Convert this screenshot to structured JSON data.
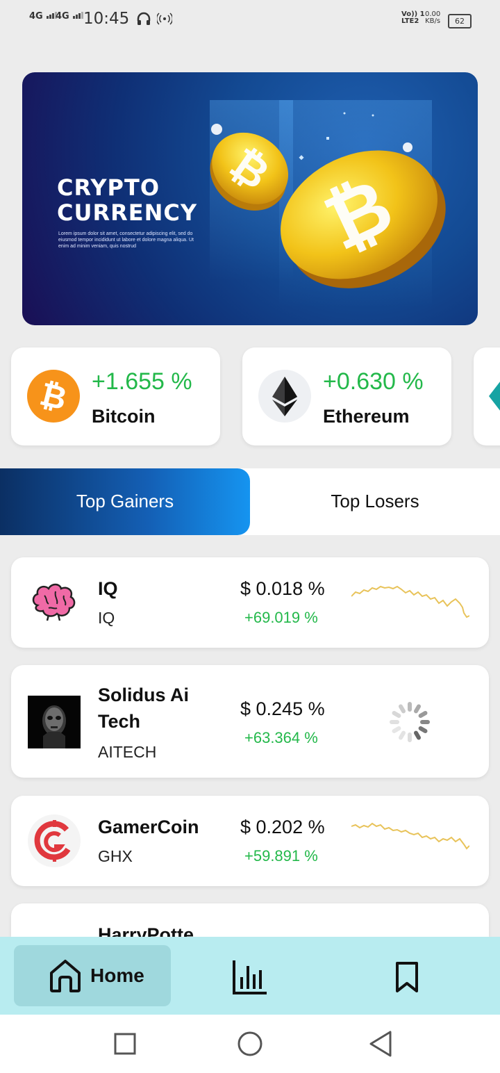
{
  "status_bar": {
    "network_1": "4G",
    "network_2": "4G",
    "time": "10:45",
    "volte": "Vo)) 1",
    "lte": "LTE2",
    "speed": "0.00",
    "speed_unit": "KB/s",
    "battery": "62"
  },
  "banner": {
    "title": "CRYPTO\nCURRENCY",
    "subtitle": "Lorem ipsum dolor sit amet, consectetur adipiscing elit, sed do eiusmod tempor incididunt ut labore et dolore magna aliqua. Ut enim ad minim veniam, quis nostrud"
  },
  "coins": [
    {
      "name": "Bitcoin",
      "change": "+1.655 %",
      "icon": "bitcoin-icon"
    },
    {
      "name": "Ethereum",
      "change": "+0.630 %",
      "icon": "ethereum-icon"
    }
  ],
  "tabs": {
    "gainers": "Top Gainers",
    "losers": "Top Losers",
    "active": "gainers"
  },
  "gainers": [
    {
      "name": "IQ",
      "symbol": "IQ",
      "price": "$ 0.018 %",
      "change": "+69.019 %",
      "icon": "brain-icon"
    },
    {
      "name": "Solidus Ai Tech",
      "symbol": "AITECH",
      "price": "$ 0.245 %",
      "change": "+63.364 %",
      "icon": "robot-face-icon"
    },
    {
      "name": "GamerCoin",
      "symbol": "GHX",
      "price": "$ 0.202 %",
      "change": "+59.891 %",
      "icon": "gamercoin-icon"
    },
    {
      "name": "HarryPotte",
      "icon": "coin-icon"
    }
  ],
  "bottom_nav": {
    "home": "Home",
    "items": [
      "home-icon",
      "chart-icon",
      "bookmark-icon"
    ]
  },
  "colors": {
    "positive": "#23b84a",
    "sparkline": "#e8c35a",
    "nav_bg": "#b8ecf0",
    "tab_gradient_start": "#0b2f63",
    "tab_gradient_end": "#1594f0"
  }
}
